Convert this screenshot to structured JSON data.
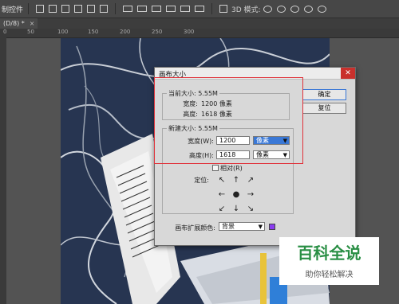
{
  "app": {
    "panel_label": "制控件",
    "mode_3d_label": "3D 模式:"
  },
  "document_tab": {
    "label": "(D/8) *",
    "close": "×"
  },
  "ruler": {
    "labels": [
      "0",
      "50",
      "100",
      "150",
      "200",
      "250",
      "300"
    ]
  },
  "dialog": {
    "title": "画布大小",
    "close_glyph": "✕",
    "current_size": {
      "legend": "当前大小: 5.55M",
      "width_label": "宽度:",
      "width_value": "1200 像素",
      "height_label": "高度:",
      "height_value": "1618 像素"
    },
    "new_size": {
      "legend": "新建大小: 5.55M",
      "width_label": "宽度(W):",
      "width_value": "1200",
      "width_unit": "像素",
      "height_label": "高度(H):",
      "height_value": "1618",
      "height_unit": "像素",
      "relative_label": "相对(R)",
      "anchor_label": "定位:"
    },
    "anchor_arrows": [
      "↖",
      "↑",
      "↗",
      "←",
      "●",
      "→",
      "↙",
      "↓",
      "↘"
    ],
    "extension_color": {
      "label": "画布扩展颜色:",
      "value": "背景",
      "swatch_color": "#8a3df0"
    },
    "buttons": {
      "ok": "确定",
      "reset": "复位"
    }
  },
  "watermark": {
    "title": "百科全说",
    "subtitle": "助你轻松解决"
  },
  "colors": {
    "highlight_box": "#e0323a",
    "accent_blue": "#3a78d6"
  }
}
